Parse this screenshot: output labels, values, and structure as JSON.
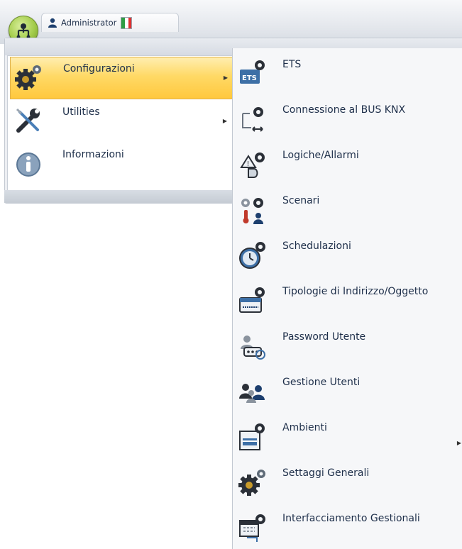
{
  "header": {
    "user_name": "Administrator",
    "flag_colors": [
      "#2f9e44",
      "#ffffff",
      "#e03131"
    ]
  },
  "main_menu": {
    "items": [
      {
        "label": "Configurazioni",
        "icon": "gears-icon",
        "has_submenu": true,
        "active": true
      },
      {
        "label": "Utilities",
        "icon": "tools-icon",
        "has_submenu": true,
        "active": false
      },
      {
        "label": "Informazioni",
        "icon": "info-icon",
        "has_submenu": false,
        "active": false
      }
    ]
  },
  "submenu": {
    "items": [
      {
        "label": "ETS",
        "icon": "ets-icon"
      },
      {
        "label": "Connessione al BUS KNX",
        "icon": "bus-connection-icon"
      },
      {
        "label": "Logiche/Allarmi",
        "icon": "logic-alarm-icon"
      },
      {
        "label": "Scenari",
        "icon": "scenarios-icon"
      },
      {
        "label": "Schedulazioni",
        "icon": "clock-icon"
      },
      {
        "label": "Tipologie di Indirizzo/Oggetto",
        "icon": "address-type-icon"
      },
      {
        "label": "Password Utente",
        "icon": "user-password-icon"
      },
      {
        "label": "Gestione Utenti",
        "icon": "users-icon"
      },
      {
        "label": "Ambienti",
        "icon": "rooms-icon"
      },
      {
        "label": "Settaggi Generali",
        "icon": "general-settings-icon"
      },
      {
        "label": "Interfacciamento Gestionali",
        "icon": "calendar-interface-icon"
      }
    ]
  },
  "colors": {
    "highlight": "#ffd966",
    "text": "#1e2f4a",
    "gear_dark": "#2b3038",
    "icon_blue": "#3d6fa6"
  }
}
